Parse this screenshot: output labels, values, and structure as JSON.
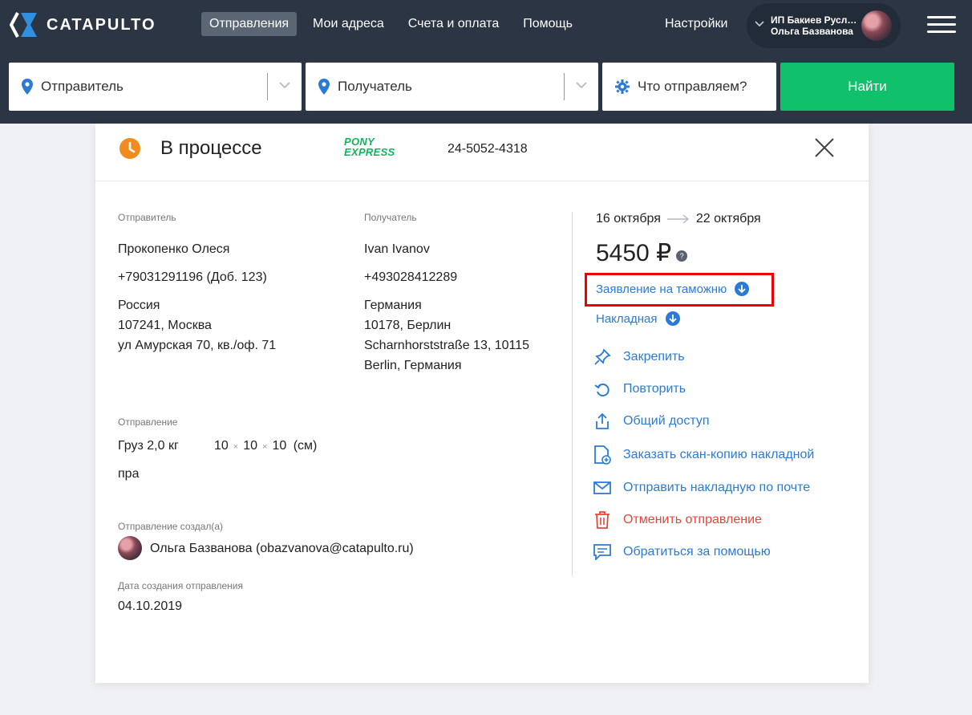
{
  "header": {
    "brand": "CATAPULTO",
    "nav": [
      {
        "label": "Отправления",
        "active": true
      },
      {
        "label": "Мои адреса",
        "active": false
      },
      {
        "label": "Счета и оплата",
        "active": false
      },
      {
        "label": "Помощь",
        "active": false
      }
    ],
    "settings_label": "Настройки",
    "user": {
      "company": "ИП Бакиев Русла...",
      "name": "Ольга Базванова"
    }
  },
  "search": {
    "sender_label": "Отправитель",
    "recipient_label": "Получатель",
    "what_label": "Что отправляем?",
    "find_button": "Найти"
  },
  "shipment": {
    "status": "В процессе",
    "carrier_line1": "PONY",
    "carrier_line2": "EXPRESS",
    "tracking": "24-5052-4318",
    "sender": {
      "caption": "Отправитель",
      "name": "Прокопенко Олеся",
      "phone": "+79031291196 (Доб. 123)",
      "country": "Россия",
      "city": "107241, Москва",
      "street": "ул Амурская 70, кв./оф. 71"
    },
    "recipient": {
      "caption": "Получатель",
      "name": "Ivan Ivanov",
      "phone": "+493028412289",
      "country": "Германия",
      "city": "10178, Берлин",
      "street": "Scharnhorststraße 13, 10115",
      "city2": "Berlin, Германия"
    },
    "parcel": {
      "caption": "Отправление",
      "weight": "Груз 2,0 кг",
      "d1": "10",
      "d2": "10",
      "d3": "10",
      "unit": "(см)",
      "note": "пра"
    },
    "created_by": {
      "caption": "Отправление создал(а)",
      "value": "Ольга Базванова (obazvanova@catapulto.ru)"
    },
    "created_date": {
      "caption": "Дата создания отправления",
      "value": "04.10.2019"
    },
    "date_from": "16 октября",
    "date_to": "22 октября",
    "price": "5450 ₽",
    "price_help": "?",
    "customs_doc": "Заявление на таможню",
    "waybill_doc": "Накладная",
    "actions": {
      "pin": "Закрепить",
      "repeat": "Повторить",
      "share": "Общий доступ",
      "scan": "Заказать скан-копию накладной",
      "email": "Отправить накладную по почте",
      "cancel": "Отменить отправление",
      "help": "Обратиться за помощью"
    }
  },
  "colors": {
    "topbar": "#2b3544",
    "accent_green": "#10c06a",
    "link_blue": "#2b7bd6",
    "danger_red": "#e4463c",
    "status_orange": "#f08c1e"
  }
}
